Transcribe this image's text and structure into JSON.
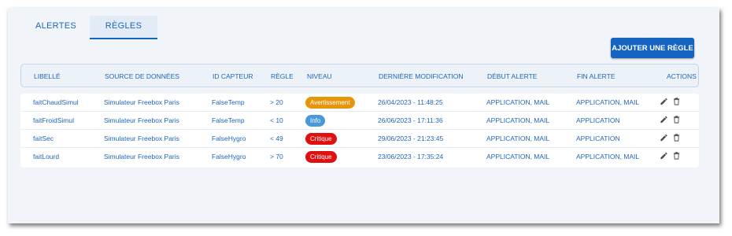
{
  "tabs": [
    {
      "label": "ALERTES",
      "active": false
    },
    {
      "label": "RÈGLES",
      "active": true
    }
  ],
  "add_button_label": "AJOUTER UNE RÈGLE",
  "table": {
    "headers": {
      "libelle": "LIBELLÉ",
      "source": "SOURCE DE DONNÉES",
      "capteur": "ID CAPTEUR",
      "regle": "RÈGLE",
      "niveau": "NIVEAU",
      "modif": "DERNIÈRE MODIFICATION",
      "debut": "DÉBUT ALERTE",
      "fin": "FIN ALERTE",
      "actions": "ACTIONS"
    },
    "rows": [
      {
        "libelle": "faitChaudSimul",
        "source": "Simulateur Freebox Paris",
        "capteur": "FalseTemp",
        "regle": "> 20",
        "niveau": "Avertissement",
        "modif": "26/04/2023 - 11:48:25",
        "debut": "APPLICATION, MAIL",
        "fin": "APPLICATION, MAIL"
      },
      {
        "libelle": "faitFroidSimul",
        "source": "Simulateur Freebox Paris",
        "capteur": "FalseTemp",
        "regle": "< 10",
        "niveau": "Info",
        "modif": "26/06/2023 - 17:11:36",
        "debut": "APPLICATION, MAIL",
        "fin": "APPLICATION"
      },
      {
        "libelle": "faitSec",
        "source": "Simulateur Freebox Paris",
        "capteur": "FalseHygro",
        "regle": "< 49",
        "niveau": "Critique",
        "modif": "29/06/2023 - 21:23:45",
        "debut": "APPLICATION, MAIL",
        "fin": "APPLICATION"
      },
      {
        "libelle": "faitLourd",
        "source": "Simulateur Freebox Paris",
        "capteur": "FalseHygro",
        "regle": "> 70",
        "niveau": "Critique",
        "modif": "23/06/2023 - 17:35:24",
        "debut": "APPLICATION, MAIL",
        "fin": "APPLICATION, MAIL"
      }
    ]
  },
  "level_colors": {
    "Avertissement": "#e8950c",
    "Info": "#4a97d9",
    "Critique": "#e01010"
  },
  "icons": {
    "edit": "pencil-icon",
    "delete": "trash-icon"
  }
}
